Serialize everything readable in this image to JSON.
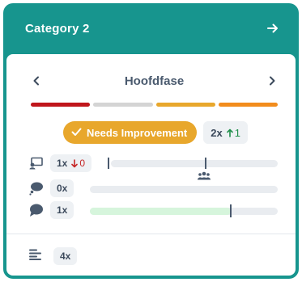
{
  "header": {
    "title": "Category 2",
    "action_icon": "arrow-right-icon"
  },
  "phase": {
    "title": "Hoofdfase",
    "prev_icon": "chevron-left-icon",
    "next_icon": "chevron-right-icon"
  },
  "segments": [
    {
      "color": "#c0161b"
    },
    {
      "color": "#d4d4d4"
    },
    {
      "color": "#e8a72c"
    },
    {
      "color": "#f28c1c"
    }
  ],
  "status": {
    "label": "Needs Improvement",
    "icon": "check-icon",
    "color": "#e8a72c",
    "count": "2x",
    "delta": "1",
    "delta_direction": "up"
  },
  "metrics": [
    {
      "icon": "presentation-icon",
      "count": "1x",
      "delta": "0",
      "delta_direction": "down",
      "fill_fraction": 0.0,
      "marker_fraction": 0.57,
      "has_group_icon": true
    },
    {
      "icon": "thought-bubble-icon",
      "count": "0x",
      "fill_fraction": 0.0
    },
    {
      "icon": "chat-bubble-icon",
      "count": "1x",
      "fill_fraction": 0.75,
      "marker_fraction": 0.75
    }
  ],
  "footer": {
    "icon": "list-lines-icon",
    "count": "4x"
  },
  "colors": {
    "brand": "#17958e",
    "up": "#1f8f4a",
    "down": "#c62828"
  }
}
